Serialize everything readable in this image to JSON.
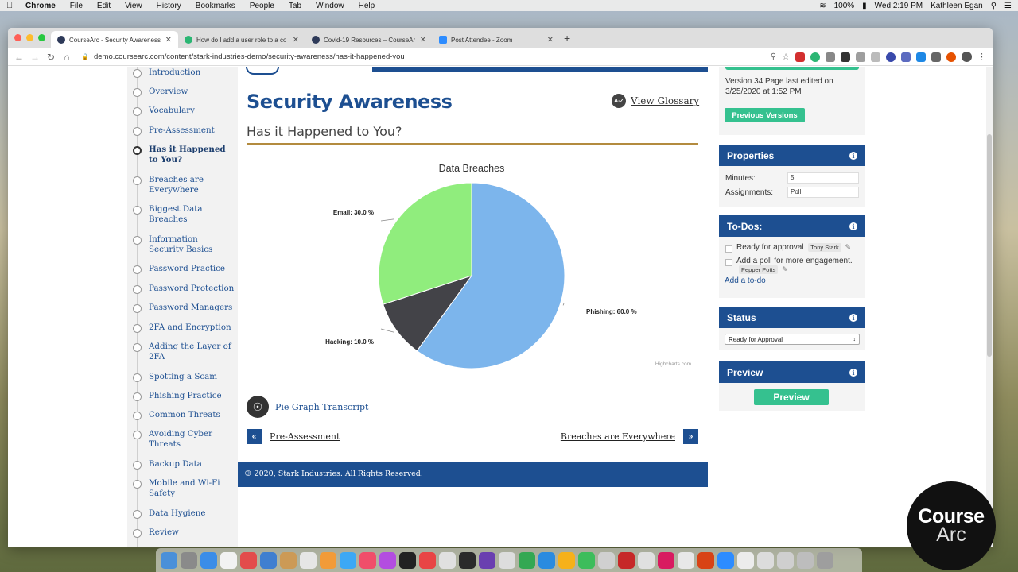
{
  "menubar": {
    "app": "Chrome",
    "items": [
      "File",
      "Edit",
      "View",
      "History",
      "Bookmarks",
      "People",
      "Tab",
      "Window",
      "Help"
    ],
    "battery": "100%",
    "clock": "Wed 2:19 PM",
    "user": "Kathleen Egan"
  },
  "browser": {
    "tabs": [
      {
        "label": "CourseArc - Security Awareness",
        "color": "#2e3a59"
      },
      {
        "label": "How do I add a user role to a co",
        "color": "#2bb673"
      },
      {
        "label": "Covid-19 Resources – CourseAr",
        "color": "#2e3a59"
      },
      {
        "label": "Post Attendee - Zoom",
        "color": "#2d8cff"
      }
    ],
    "url": "demo.coursearc.com/content/stark-industries-demo/security-awareness/has-it-happened-you"
  },
  "toc": {
    "items": [
      {
        "label": "Introduction",
        "current": false
      },
      {
        "label": "Overview",
        "current": false
      },
      {
        "label": "Vocabulary",
        "current": false
      },
      {
        "label": "Pre-Assessment",
        "current": false
      },
      {
        "label": "Has it Happened to You?",
        "current": true
      },
      {
        "label": "Breaches are Everywhere",
        "current": false
      },
      {
        "label": "Biggest Data Breaches",
        "current": false
      },
      {
        "label": "Information Security Basics",
        "current": false
      },
      {
        "label": "Password Practice",
        "current": false
      },
      {
        "label": "Password Protection",
        "current": false
      },
      {
        "label": "Password Managers",
        "current": false
      },
      {
        "label": "2FA and Encryption",
        "current": false
      },
      {
        "label": "Adding the Layer of 2FA",
        "current": false
      },
      {
        "label": "Spotting a Scam",
        "current": false
      },
      {
        "label": "Phishing Practice",
        "current": false
      },
      {
        "label": "Common Threats",
        "current": false
      },
      {
        "label": "Avoiding Cyber Threats",
        "current": false
      },
      {
        "label": "Backup Data",
        "current": false
      },
      {
        "label": "Mobile and Wi-Fi Safety",
        "current": false
      },
      {
        "label": "Data Hygiene",
        "current": false
      },
      {
        "label": "Review",
        "current": false
      }
    ]
  },
  "content": {
    "title": "Security Awareness",
    "glossary_icon": "A-Z",
    "glossary_label": "View Glossary",
    "subtitle": "Has it Happened to You?",
    "transcript_label": "Pie Graph Transcript",
    "prev_label": "Pre-Assessment",
    "next_label": "Breaches are Everywhere",
    "prev_icon": "«",
    "next_icon": "»",
    "footer": "© 2020, Stark Industries. All Rights Reserved.",
    "credit": "Highcharts.com"
  },
  "chart_data": {
    "type": "pie",
    "title": "Data Breaches",
    "slices": [
      {
        "name": "Phishing",
        "value": 60.0,
        "label": "Phishing: 60.0 %",
        "color": "#7cb5ec"
      },
      {
        "name": "Hacking",
        "value": 10.0,
        "label": "Hacking: 10.0 %",
        "color": "#434348"
      },
      {
        "name": "Email",
        "value": 30.0,
        "label": "Email: 30.0 %",
        "color": "#90ed7d"
      }
    ]
  },
  "sidebar": {
    "version_line": "Version 34   Page last edited on",
    "version_date": "3/25/2020 at 1:52 PM",
    "previous_versions": "Previous Versions",
    "properties_title": "Properties",
    "minutes_label": "Minutes:",
    "minutes_value": "5",
    "assignments_label": "Assignments:",
    "assignments_value": "Poll",
    "todos_title": "To-Dos:",
    "todo1_text": "Ready for approval",
    "todo1_user": "Tony Stark",
    "todo2_text": "Add a poll for more engagement.",
    "todo2_user": "Pepper Potts",
    "add_todo": "Add a to-do",
    "status_title": "Status",
    "status_value": "Ready for Approval",
    "preview_title": "Preview",
    "preview_button": "Preview",
    "info_glyph": "i"
  },
  "watermark": {
    "top": "Course",
    "bottom": "Arc"
  },
  "colors": {
    "brand_blue": "#1d4f91",
    "accent_green": "#35c18f",
    "rule_gold": "#b38b3f"
  }
}
